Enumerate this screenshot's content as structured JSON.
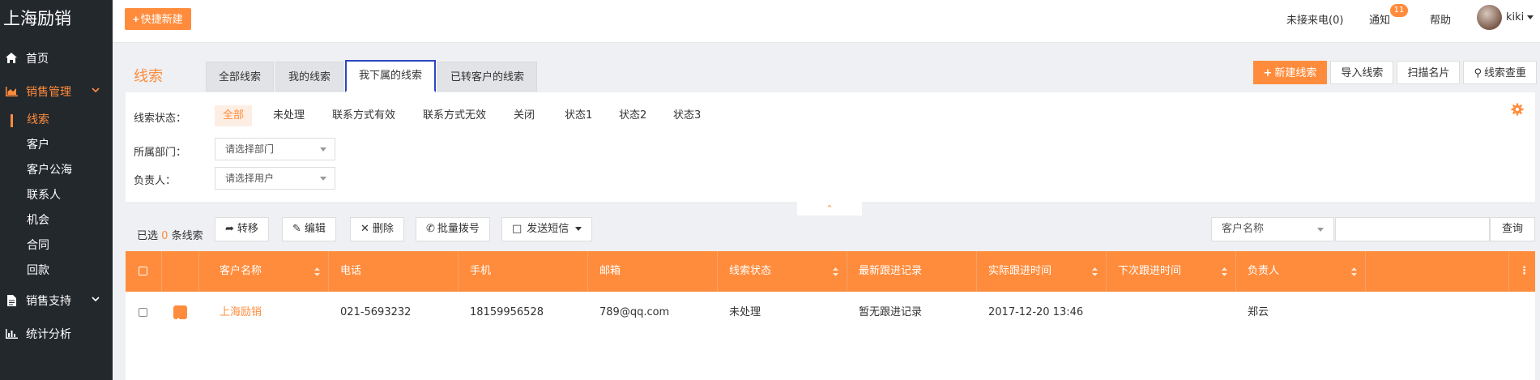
{
  "sidebar": {
    "brand": "上海励销",
    "items": [
      {
        "label": "首页"
      },
      {
        "label": "销售管理"
      },
      {
        "label": "销售支持"
      },
      {
        "label": "统计分析"
      }
    ],
    "sub_items": [
      "线索",
      "客户",
      "客户公海",
      "联系人",
      "机会",
      "合同",
      "回款"
    ]
  },
  "topbar": {
    "quick_new": "快捷新建",
    "missed_calls": "未接来电(0)",
    "notifications": "通知",
    "notification_count": "11",
    "help": "帮助",
    "user": "kiki"
  },
  "page": {
    "title": "线索",
    "tabs": [
      "全部线索",
      "我的线索",
      "我下属的线索",
      "已转客户的线索"
    ],
    "actions": [
      "新建线索",
      "导入线索",
      "扫描名片",
      "线索查重"
    ]
  },
  "filters": {
    "status_label": "线索状态：",
    "status_options": [
      "全部",
      "未处理",
      "联系方式有效",
      "联系方式无效",
      "关闭",
      "状态1",
      "状态2",
      "状态3"
    ],
    "dept_label": "所属部门：",
    "dept_placeholder": "请选择部门",
    "owner_label": "负责人：",
    "owner_placeholder": "请选择用户"
  },
  "toolbar": {
    "selected_prefix": "已选",
    "selected_count": "0",
    "selected_suffix": "条线索",
    "transfer": "转移",
    "edit": "编辑",
    "delete": "删除",
    "batch_dial": "批量拨号",
    "send_sms": "发送短信",
    "search_field": "客户名称",
    "search_btn": "查询"
  },
  "table": {
    "headers": [
      "客户名称",
      "电话",
      "手机",
      "邮箱",
      "线索状态",
      "最新跟进记录",
      "实际跟进时间",
      "下次跟进时间",
      "负责人"
    ],
    "rows": [
      {
        "name": "上海励销",
        "phone": "021-5693232",
        "mobile": "18159956528",
        "email": "789@qq.com",
        "status": "未处理",
        "latest": "暂无跟进记录",
        "actual_time": "2017-12-20 13:46",
        "next_time": "",
        "owner": "郑云"
      }
    ]
  },
  "colors": {
    "accent": "#ff8c3c",
    "sidebar_bg": "#23282d"
  }
}
